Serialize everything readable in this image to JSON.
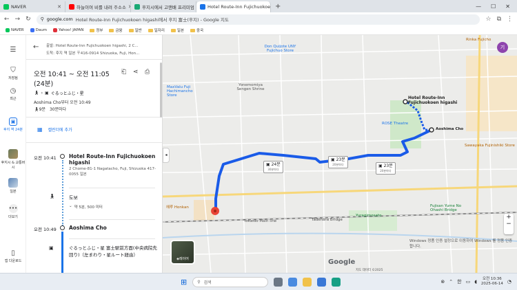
{
  "browser": {
    "tabs": [
      {
        "title": "NAVER",
        "color": "#03c75a"
      },
      {
        "title": "하늘이여 비를 내려 주소소",
        "color": "#ff0000"
      },
      {
        "title": "후지시에서 고맨배 프리미엄",
        "color": "#19a974"
      },
      {
        "title": "Hotel Route-Inn Fujichuokoen",
        "color": "#1a73e8",
        "active": true
      }
    ],
    "url_domain": "google.com",
    "url_rest": "Hotel Route-Inn Fujichuokoen higashi에서 후지 富士(후지) - Google 지도",
    "bookmarks": [
      "NAVER",
      "Daum",
      "Yahoo! JAPAN",
      "정부",
      "금융",
      "일반",
      "일자리",
      "일본",
      "중국"
    ]
  },
  "rail": {
    "menu_icon": "menu-icon",
    "items": [
      {
        "label": "저장됨",
        "icon": "bookmark-icon"
      },
      {
        "label": "최근",
        "icon": "history-icon"
      },
      {
        "label": "후지 역 24분",
        "icon": "transit-icon"
      },
      {
        "label": "후지시 & 교통버시",
        "icon": "thumbnail-icon"
      },
      {
        "label": "일본",
        "icon": "thumbnail-icon"
      },
      {
        "label": "더보기",
        "icon": "more-icon"
      },
      {
        "label": "앱 다운로드",
        "icon": "phone-icon"
      }
    ]
  },
  "panel": {
    "origin": "출발: Hotel Route-Inn Fujichuokoen higashi, 2 C...",
    "destination": "도착: 후지 역 일본 〒416-0914 Shizuoka, Fuji, Hon...",
    "time_range": "오전 10:41 ~ 오전 11:05",
    "duration": "(24분)",
    "steps_summary": "ぐるっとふじ・星",
    "depart_info": "Aoshima Cho부터 오전 10:49",
    "walk_time": "9분",
    "frequency": "30분마다",
    "calendar_label": "캘린더에 추가",
    "stop1_time": "오전 10:41",
    "stop1_name": "Hotel Route-Inn Fujichuokoen higashi",
    "stop1_address": "2 Chome-81-1 Nagatacho, Fuji, Shizuoka 417-0055 일본",
    "walk_label": "도보",
    "walk_detail": "약 5분, 500 미터",
    "stop2_time": "오전 10:49",
    "stop2_name": "Aoshima Cho",
    "bus_desc": "ぐるっとふじ・星  富士駅前方面(中央病院先回り)（左まわり・星ルート経由）"
  },
  "map": {
    "hotel_label": "Hotel Route-Inn Fujichuokoen higashi",
    "aoshima_label": "Aoshima Cho",
    "route_badges": [
      {
        "time": "24분",
        "sub": "30분마다"
      },
      {
        "time": "23분",
        "sub": "20분마다"
      },
      {
        "time": "23분",
        "sub": "20분마다"
      }
    ],
    "places": [
      "Don Quijote UNY Fujichuo Store",
      "Yonemomiya Sengen Shrine",
      "MaxValu Fuji Hachimancho Store",
      "ROSE Theatre",
      "Tadehara Bridge",
      "Yuragimosato",
      "Fujisan Yume No Ohashi Bridge",
      "Sawayaka Fujinishiki Store",
      "Rinka Fujicho",
      "Tokaido Main line",
      "헤루 Honkan"
    ],
    "layer_label": "레이어",
    "watermark": "Google",
    "footer": "지도 데이터 ©2025",
    "windows_notice": "Windows 정품 인증 설정으로 이동하여 Windows 를 정품 인증합니다."
  },
  "taskbar": {
    "search_placeholder": "검색",
    "ime": "한",
    "time": "오전 10:36",
    "date": "2025-06-14"
  }
}
